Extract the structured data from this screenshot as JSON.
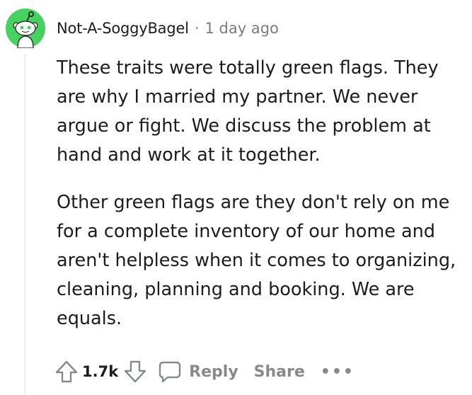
{
  "comment": {
    "username": "Not-A-SoggyBagel",
    "separator": "·",
    "timestamp": "1 day ago",
    "paragraphs": [
      "These traits were totally green flags. They are why I married my partner. We never argue or fight. We discuss the problem at hand and work at it together.",
      "Other green flags are they don't rely on me for a complete inventory of our home and aren't helpless when it comes to organizing, cleaning, planning and booking. We are equals."
    ]
  },
  "actions": {
    "vote_count": "1.7k",
    "reply_label": "Reply",
    "share_label": "Share",
    "more_label": "•••"
  },
  "colors": {
    "avatar_bg": "#46d160",
    "meta_gray": "#878a8c",
    "text": "#1c1c1c"
  },
  "icons": {
    "upvote": "upvote-arrow-icon",
    "downvote": "downvote-arrow-icon",
    "reply": "speech-bubble-icon",
    "avatar": "snoo-avatar-icon"
  }
}
